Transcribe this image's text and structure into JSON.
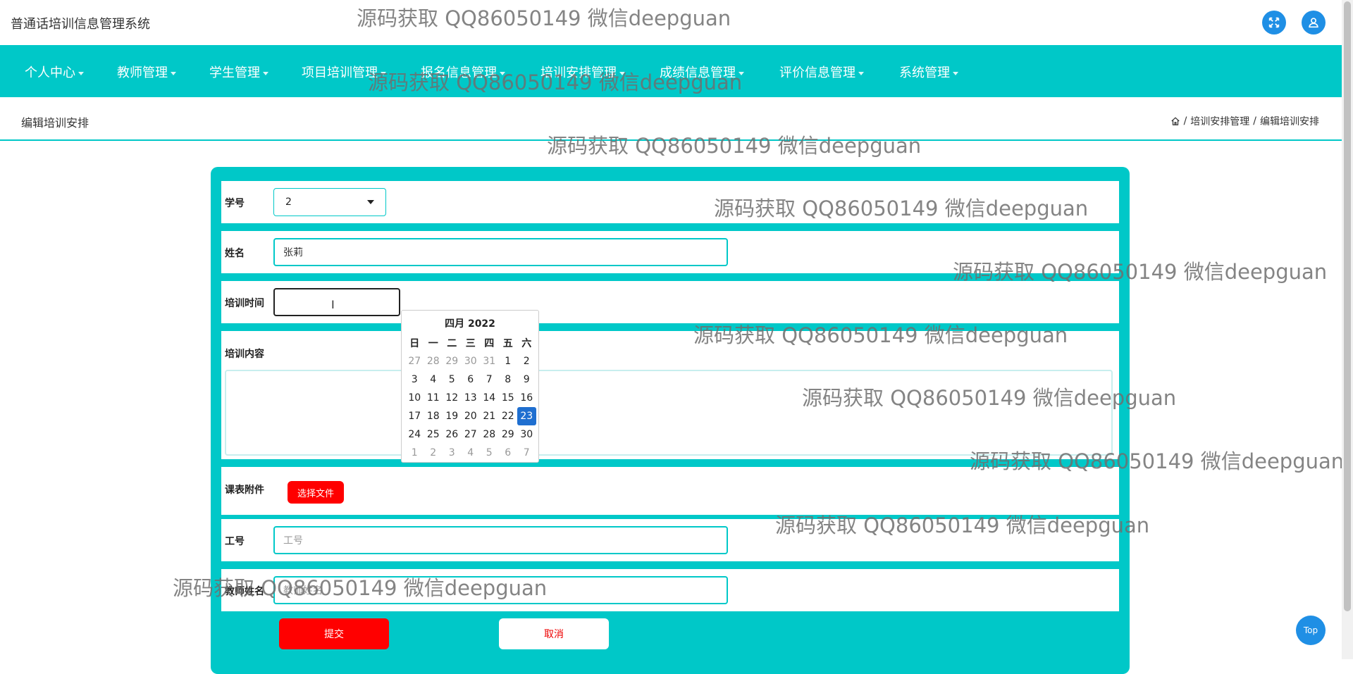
{
  "app": {
    "title": "普通话培训信息管理系统"
  },
  "nav": {
    "items": [
      {
        "label": "个人中心"
      },
      {
        "label": "教师管理"
      },
      {
        "label": "学生管理"
      },
      {
        "label": "项目培训管理"
      },
      {
        "label": "报名信息管理"
      },
      {
        "label": "培训安排管理"
      },
      {
        "label": "成绩信息管理"
      },
      {
        "label": "评价信息管理"
      },
      {
        "label": "系统管理"
      }
    ]
  },
  "page": {
    "title": "编辑培训安排"
  },
  "breadcrumb": {
    "items": [
      "培训安排管理",
      "编辑培训安排"
    ],
    "separator": "/"
  },
  "form": {
    "student_id": {
      "label": "学号",
      "value": "2"
    },
    "name": {
      "label": "姓名",
      "value": "张莉"
    },
    "training_time": {
      "label": "培训时间",
      "value": ""
    },
    "training_content": {
      "label": "培训内容",
      "value": ""
    },
    "attachment": {
      "label": "课表附件",
      "button": "选择文件"
    },
    "employee_id": {
      "label": "工号",
      "placeholder": "工号"
    },
    "teacher_name": {
      "label": "教师姓名",
      "placeholder": "教师姓名"
    },
    "submit_label": "提交",
    "cancel_label": "取消"
  },
  "calendar": {
    "title": "四月 2022",
    "weekdays": [
      "日",
      "一",
      "二",
      "三",
      "四",
      "五",
      "六"
    ],
    "days": [
      [
        "27",
        "28",
        "29",
        "30",
        "31",
        "1",
        "2"
      ],
      [
        "3",
        "4",
        "5",
        "6",
        "7",
        "8",
        "9"
      ],
      [
        "10",
        "11",
        "12",
        "13",
        "14",
        "15",
        "16"
      ],
      [
        "17",
        "18",
        "19",
        "20",
        "21",
        "22",
        "23"
      ],
      [
        "24",
        "25",
        "26",
        "27",
        "28",
        "29",
        "30"
      ],
      [
        "1",
        "2",
        "3",
        "4",
        "5",
        "6",
        "7"
      ]
    ],
    "selected": "23"
  },
  "watermark": {
    "text": "源码获取 QQ86050149 微信deepguan"
  },
  "top_button": {
    "label": "Top"
  },
  "colors": {
    "accent": "#00c8c8",
    "primary_blue": "#1f8fe5",
    "danger": "#ff0000",
    "selected_day": "#1f6fd0"
  },
  "icons": {
    "fullscreen": "expand-arrows-icon",
    "user": "user-icon",
    "home": "home-icon"
  }
}
